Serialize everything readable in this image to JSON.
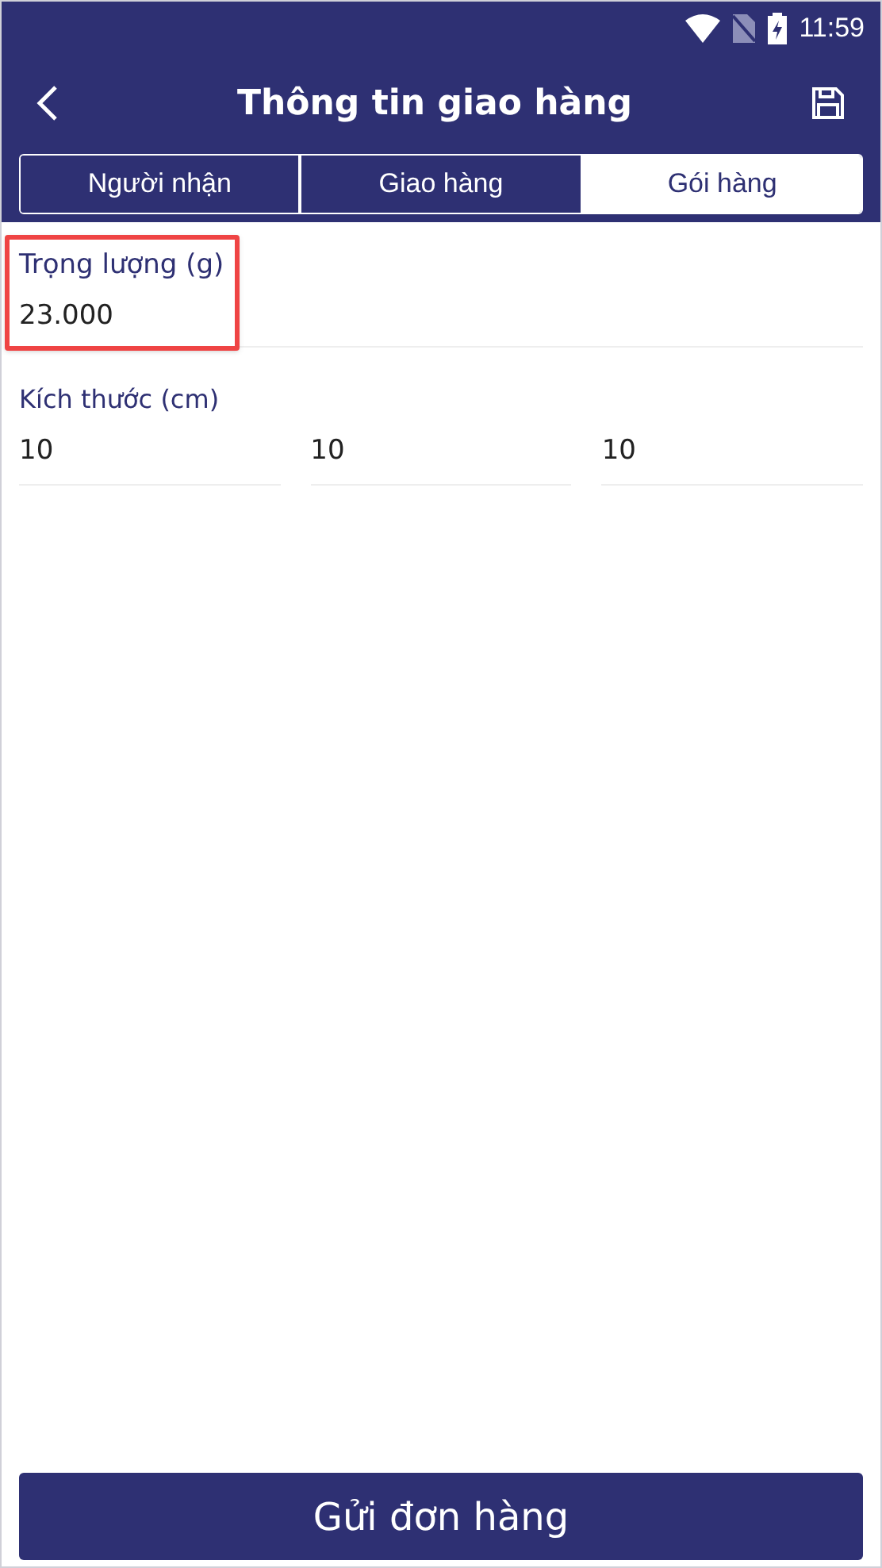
{
  "status_bar": {
    "time": "11:59"
  },
  "header": {
    "title": "Thông tin giao hàng"
  },
  "tabs": [
    {
      "label": "Người nhận",
      "selected": false
    },
    {
      "label": "Giao hàng",
      "selected": false
    },
    {
      "label": "Gói hàng",
      "selected": true
    }
  ],
  "weight": {
    "label": "Trọng lượng (g)",
    "value": "23.000",
    "highlighted": true
  },
  "dimensions": {
    "label": "Kích thước (cm)",
    "values": [
      "10",
      "10",
      "10"
    ]
  },
  "submit_button": {
    "label": "Gửi đơn hàng"
  }
}
